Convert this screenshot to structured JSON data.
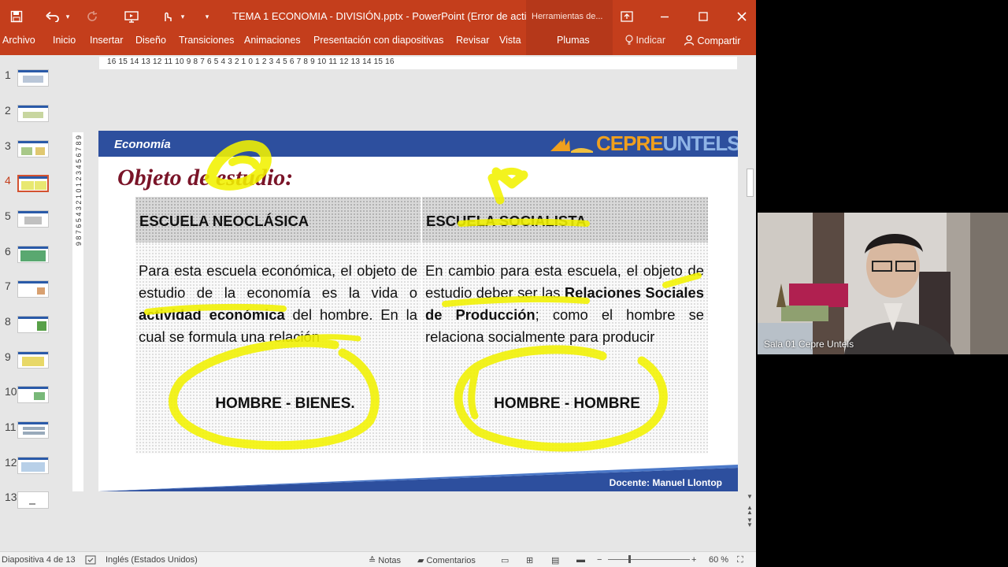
{
  "titlebar": {
    "doc_title": "TEMA 1 ECONOMIA - DIVISIÓN.pptx - PowerPoint (Error de acti...",
    "tools_tab": "Herramientas de...",
    "icons": [
      "save-icon",
      "undo-icon",
      "redo-icon",
      "present-icon",
      "touch-mode-icon",
      "customize-icon"
    ]
  },
  "ribbon": {
    "tabs": [
      "Archivo",
      "Inicio",
      "Insertar",
      "Diseño",
      "Transiciones",
      "Animaciones",
      "Presentación con diapositivas",
      "Revisar",
      "Vista",
      "Plumas"
    ],
    "tell_me": "Indicar",
    "share": "Compartir"
  },
  "ruler": {
    "horizontal": "16 15 14 13 12 11 10 9 8 7 6 5 4 3 2 1 0 1 2 3 4 5 6 7 8 9 10 11 12 13 14 15 16",
    "vertical": "9 8 7 6 5 4 3 2 1 0 1 2 3 4 5 6 7 8 9"
  },
  "thumbnails": {
    "numbers": [
      "1",
      "2",
      "3",
      "4",
      "5",
      "6",
      "7",
      "8",
      "9",
      "10",
      "11",
      "12",
      "13"
    ],
    "active": "4"
  },
  "slide": {
    "header_label": "Economía",
    "logo_text_a": "CEPRE",
    "logo_text_b": "UNTELS",
    "title": "Objeto de estudio:",
    "left": {
      "heading": "ESCUELA NEOCLÁSICA",
      "text_1": "Para esta escuela económica, el objeto de estudio de la economía es la vida o",
      "text_bold": "actividad económica",
      "text_2": "del hombre. En la cual se formula una relación",
      "relation": "HOMBRE - BIENES."
    },
    "right": {
      "heading": "ESCUELA SOCIALISTA",
      "text_1": "En cambio para esta escuela, el objeto de estudio deber ser las",
      "text_bold": "Relaciones Sociales de Producción",
      "text_2": "; como el hombre se relaciona socialmente para producir",
      "relation": "HOMBRE - HOMBRE"
    },
    "footer": "Docente: Manuel Llontop"
  },
  "status": {
    "slide_info": "Diapositiva 4 de 13",
    "language": "Inglés (Estados Unidos)",
    "notes": "Notas",
    "comments": "Comentarios",
    "zoom": "60 %"
  },
  "video": {
    "label": "Sala 01 Cepre Untels"
  },
  "colors": {
    "ppt_accent": "#c43e1c",
    "slide_blue": "#2d4f9e",
    "title_maroon": "#7a1428",
    "highlighter": "#f2f200"
  }
}
